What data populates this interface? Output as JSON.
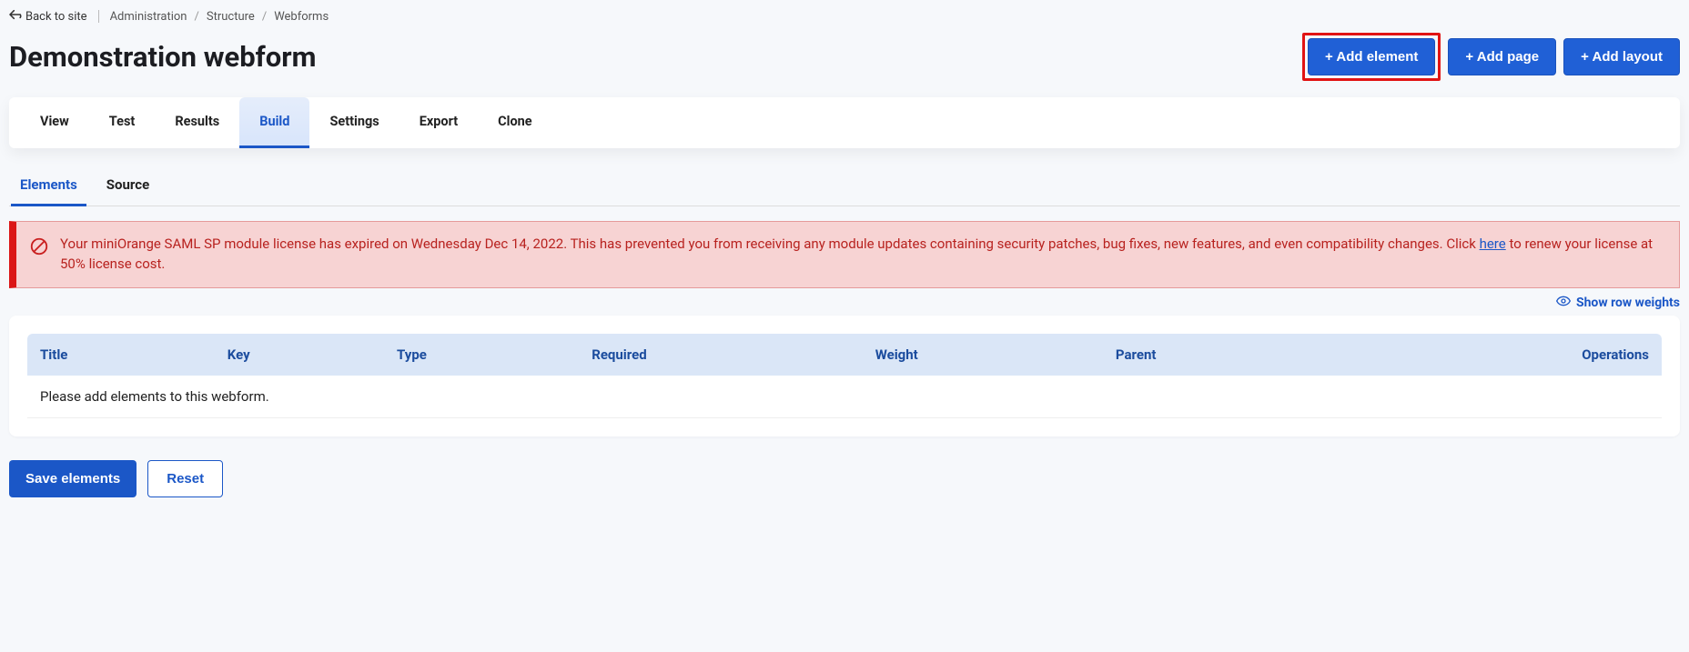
{
  "topbar": {
    "back_to_site": "Back to site",
    "breadcrumbs": [
      "Administration",
      "Structure",
      "Webforms"
    ]
  },
  "header": {
    "title": "Demonstration webform",
    "actions": {
      "add_element": "+ Add element",
      "add_page": "+ Add page",
      "add_layout": "+ Add layout"
    }
  },
  "primary_tabs": [
    "View",
    "Test",
    "Results",
    "Build",
    "Settings",
    "Export",
    "Clone"
  ],
  "primary_active": "Build",
  "secondary_tabs": [
    "Elements",
    "Source"
  ],
  "secondary_active": "Elements",
  "alert": {
    "text_before": "Your miniOrange SAML SP module license has expired on Wednesday Dec 14, 2022. This has prevented you from receiving any module updates containing security patches, bug fixes, new features, and even compatibility changes. Click ",
    "link_text": "here",
    "text_after": " to renew your license at 50% license cost."
  },
  "show_weights": "Show row weights",
  "table": {
    "headers": [
      "Title",
      "Key",
      "Type",
      "Required",
      "Weight",
      "Parent",
      "Operations"
    ],
    "empty_message": "Please add elements to this webform."
  },
  "buttons": {
    "save": "Save elements",
    "reset": "Reset"
  }
}
